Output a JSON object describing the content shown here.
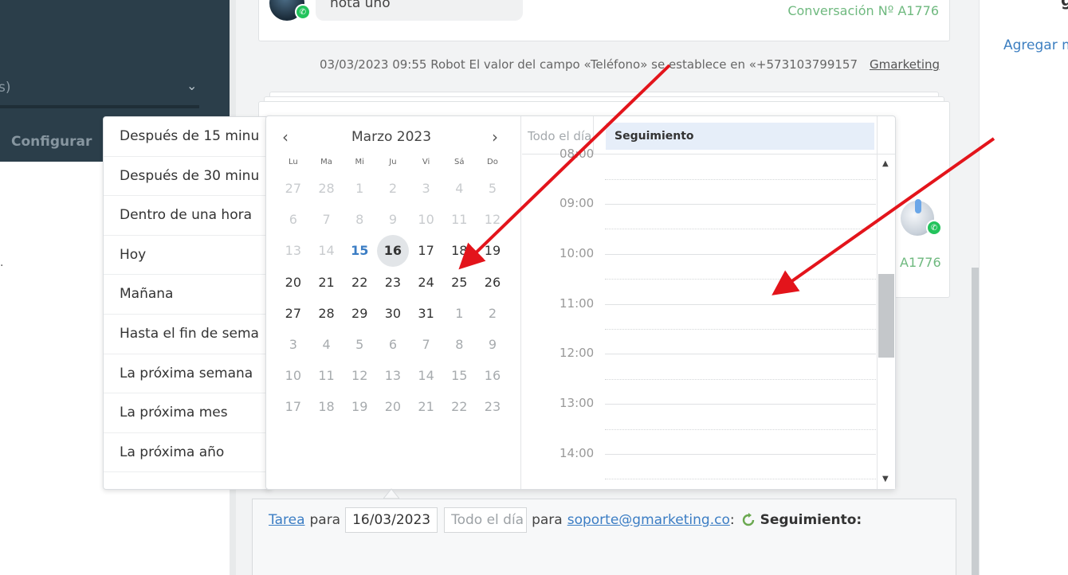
{
  "sidebar": {
    "select_fragment": "s)",
    "configure_label": "Configurar",
    "dot": "."
  },
  "feed": {
    "note_text": "nota uno",
    "conversation_link": "Conversación Nº A1776",
    "event": {
      "text": "03/03/2023 09:55 Robot El valor del campo «Teléfono» se establece en «+573103799157",
      "author": "Gmarketing"
    },
    "card_conversation_fragment": "A1776"
  },
  "right_panel": {
    "add_label": "Agregar m",
    "header_fragment": "g"
  },
  "presets": [
    "Después de 15 minu",
    "Después de 30 minu",
    "Dentro de una hora",
    "Hoy",
    "Mañana",
    "Hasta el fin de sema",
    "La próxima semana",
    "La próxima mes",
    "La próxima año"
  ],
  "calendar": {
    "month_title": "Marzo 2023",
    "weekdays": [
      "Lu",
      "Ma",
      "Mi",
      "Ju",
      "Vi",
      "Sá",
      "Do"
    ],
    "weeks": [
      [
        {
          "d": "27",
          "s": "out"
        },
        {
          "d": "28",
          "s": "out"
        },
        {
          "d": "1",
          "s": "out"
        },
        {
          "d": "2",
          "s": "out"
        },
        {
          "d": "3",
          "s": "out"
        },
        {
          "d": "4",
          "s": "out"
        },
        {
          "d": "5",
          "s": "out"
        }
      ],
      [
        {
          "d": "6",
          "s": "out"
        },
        {
          "d": "7",
          "s": "out"
        },
        {
          "d": "8",
          "s": "out"
        },
        {
          "d": "9",
          "s": "out"
        },
        {
          "d": "10",
          "s": "out"
        },
        {
          "d": "11",
          "s": "out"
        },
        {
          "d": "12",
          "s": "out"
        }
      ],
      [
        {
          "d": "13",
          "s": "out"
        },
        {
          "d": "14",
          "s": "out"
        },
        {
          "d": "15",
          "s": "today"
        },
        {
          "d": "16",
          "s": "sel"
        },
        {
          "d": "17",
          "s": ""
        },
        {
          "d": "18",
          "s": ""
        },
        {
          "d": "19",
          "s": ""
        }
      ],
      [
        {
          "d": "20",
          "s": ""
        },
        {
          "d": "21",
          "s": ""
        },
        {
          "d": "22",
          "s": ""
        },
        {
          "d": "23",
          "s": ""
        },
        {
          "d": "24",
          "s": ""
        },
        {
          "d": "25",
          "s": ""
        },
        {
          "d": "26",
          "s": ""
        }
      ],
      [
        {
          "d": "27",
          "s": ""
        },
        {
          "d": "28",
          "s": ""
        },
        {
          "d": "29",
          "s": ""
        },
        {
          "d": "30",
          "s": ""
        },
        {
          "d": "31",
          "s": ""
        },
        {
          "d": "1",
          "s": "other"
        },
        {
          "d": "2",
          "s": "other"
        }
      ],
      [
        {
          "d": "3",
          "s": "other"
        },
        {
          "d": "4",
          "s": "other"
        },
        {
          "d": "5",
          "s": "other"
        },
        {
          "d": "6",
          "s": "other"
        },
        {
          "d": "7",
          "s": "other"
        },
        {
          "d": "8",
          "s": "other"
        },
        {
          "d": "9",
          "s": "other"
        }
      ],
      [
        {
          "d": "10",
          "s": "other"
        },
        {
          "d": "11",
          "s": "other"
        },
        {
          "d": "12",
          "s": "other"
        },
        {
          "d": "13",
          "s": "other"
        },
        {
          "d": "14",
          "s": "other"
        },
        {
          "d": "15",
          "s": "other"
        },
        {
          "d": "16",
          "s": "other"
        }
      ],
      [
        {
          "d": "17",
          "s": "other"
        },
        {
          "d": "18",
          "s": "other"
        },
        {
          "d": "19",
          "s": "other"
        },
        {
          "d": "20",
          "s": "other"
        },
        {
          "d": "21",
          "s": "other"
        },
        {
          "d": "22",
          "s": "other"
        },
        {
          "d": "23",
          "s": "other"
        }
      ]
    ],
    "allday_label": "Todo el día",
    "allday_event": "Seguimiento",
    "partial_hour": "08:00",
    "hours": [
      "09:00",
      "10:00",
      "11:00",
      "12:00",
      "13:00",
      "14:00"
    ]
  },
  "task": {
    "type_link": "Tarea",
    "for_label": "para",
    "date_value": "16/03/2023",
    "time_placeholder": "Todo el día",
    "for_label_2": "para",
    "assignee": "soporte@gmarketing.co",
    "colon": ":",
    "task_type": "Seguimiento:"
  },
  "colors": {
    "sidebar_dark": "#2b3e4a",
    "link_blue": "#3b7dc4",
    "conversation_green": "#6fb97f",
    "annotation_red": "#e3141b"
  }
}
